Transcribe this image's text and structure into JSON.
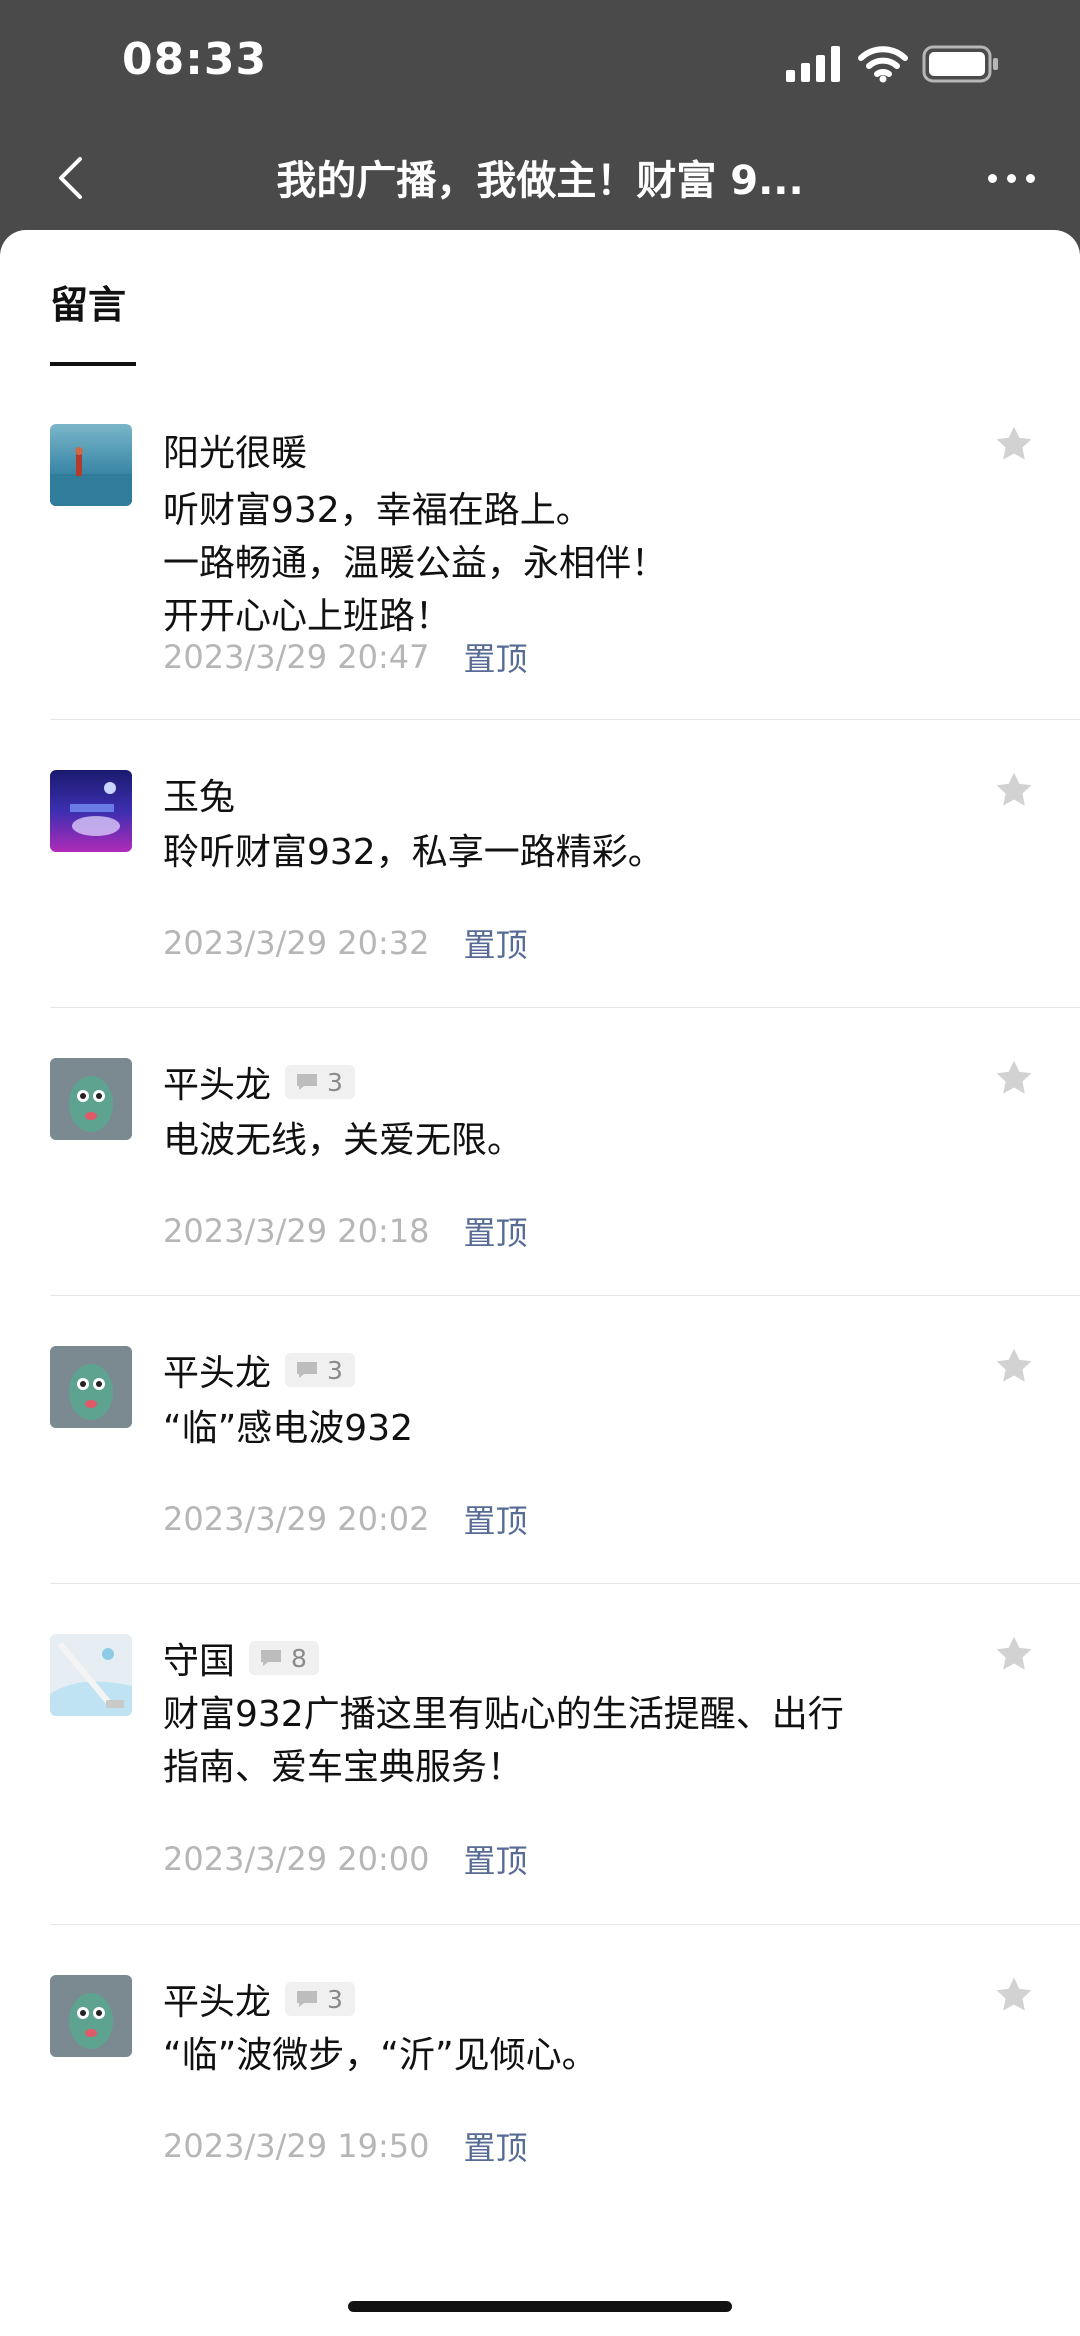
{
  "status_bar": {
    "time": "08:33"
  },
  "nav": {
    "title": "我的广播，我做主！财富 9..."
  },
  "section": {
    "tab_label": "留言"
  },
  "comments": [
    {
      "name": "阳光很暖",
      "reply_count": null,
      "lines": [
        "听财富932，幸福在路上。",
        "一路畅通，温暖公益，永相伴！",
        "开开心心上班路！"
      ],
      "time": "2023/3/29 20:47",
      "pin_label": "置顶"
    },
    {
      "name": "玉兔",
      "reply_count": null,
      "lines": [
        "聆听财富932，私享一路精彩。"
      ],
      "time": "2023/3/29 20:32",
      "pin_label": "置顶"
    },
    {
      "name": "平头龙",
      "reply_count": "3",
      "lines": [
        "电波无线，关爱无限。"
      ],
      "time": "2023/3/29 20:18",
      "pin_label": "置顶"
    },
    {
      "name": "平头龙",
      "reply_count": "3",
      "lines": [
        "“临”感电波932"
      ],
      "time": "2023/3/29 20:02",
      "pin_label": "置顶"
    },
    {
      "name": "守国",
      "reply_count": "8",
      "lines": [
        "财富932广播这里有贴心的生活提醒、出行",
        "指南、爱车宝典服务！"
      ],
      "time": "2023/3/29 20:00",
      "pin_label": "置顶"
    },
    {
      "name": "平头龙",
      "reply_count": "3",
      "lines": [
        "“临”波微步，“沂”见倾心。"
      ],
      "time": "2023/3/29 19:50",
      "pin_label": "置顶"
    }
  ],
  "icons": {
    "back": "chevron-left-icon",
    "more": "more-dots-icon",
    "star": "star-icon",
    "comment": "comment-bubble-icon"
  },
  "colors": {
    "pin_link": "#576b95",
    "timestamp": "#b6b6b6",
    "star": "#d2d2d2"
  }
}
